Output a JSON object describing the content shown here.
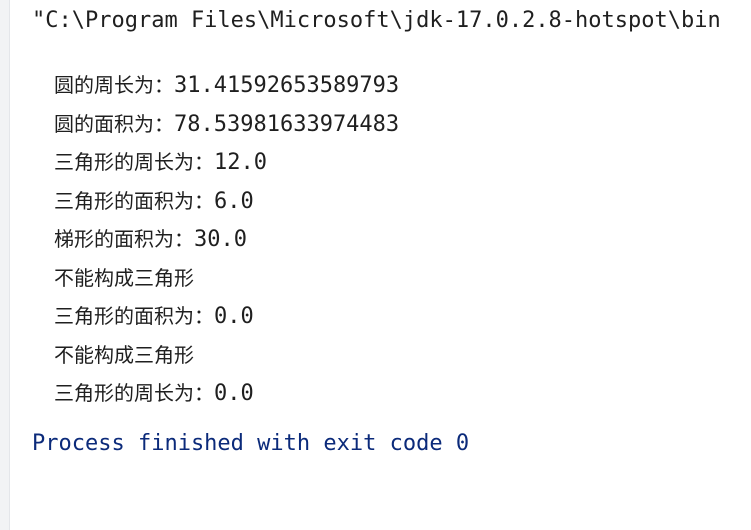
{
  "console": {
    "command": "\"C:\\Program Files\\Microsoft\\jdk-17.0.2.8-hotspot\\bin",
    "output_lines": [
      {
        "label": "圆的周长为：",
        "value": "31.41592653589793"
      },
      {
        "label": "圆的面积为：",
        "value": "78.53981633974483"
      },
      {
        "label": "三角形的周长为：",
        "value": "12.0"
      },
      {
        "label": "三角形的面积为：",
        "value": "6.0"
      },
      {
        "label": "梯形的面积为：",
        "value": "30.0"
      },
      {
        "label": "不能构成三角形",
        "value": ""
      },
      {
        "label": "三角形的面积为：",
        "value": "0.0"
      },
      {
        "label": "不能构成三角形",
        "value": ""
      },
      {
        "label": "三角形的周长为：",
        "value": "0.0"
      }
    ],
    "exit_message": "Process finished with exit code 0"
  },
  "colors": {
    "background": "#ffffff",
    "text": "#1f1f1f",
    "exit_text": "#0b2a7a",
    "gutter": "#f2f3f5"
  }
}
